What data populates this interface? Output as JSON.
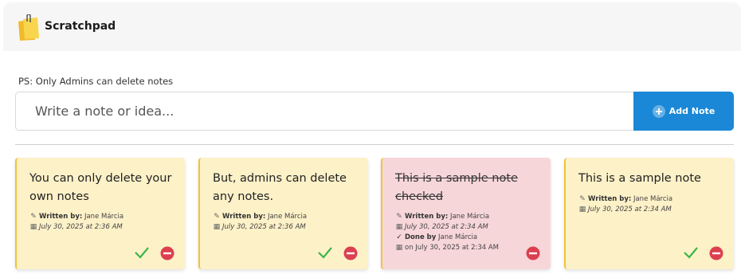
{
  "header": {
    "title": "Scratchpad",
    "logo_icon": "notepad-icon"
  },
  "notice": "PS: Only Admins can delete notes",
  "composer": {
    "placeholder": "Write a note or idea...",
    "add_label": "Add Note"
  },
  "colors": {
    "accent": "#1a88d6",
    "note_yellow": "#fdf1c8",
    "note_pink": "#f7d6da",
    "check_green": "#3bb54a",
    "delete_red": "#dc4050"
  },
  "notes": [
    {
      "text": "You can only delete your own notes",
      "written_label": "Written by:",
      "author": "Jane Márcia",
      "date": "July 30, 2025 at 2:36 AM"
    },
    {
      "text": "But, admins can delete any notes.",
      "written_label": "Written by:",
      "author": "Jane Márcia",
      "date": "July 30, 2025 at 2:36 AM"
    },
    {
      "text": "This is a sample note checked",
      "written_label": "Written by:",
      "author": "Jane Márcia",
      "date": "July 30, 2025 at 2:34 AM",
      "done_label": "Done by",
      "done_author": "Jane Márcia",
      "done_date": "on July 30, 2025 at 2:34 AM"
    },
    {
      "text": "This is a sample note",
      "written_label": "Written by:",
      "author": "Jane Márcia",
      "date": "July 30, 2025 at 2:34 AM"
    }
  ]
}
